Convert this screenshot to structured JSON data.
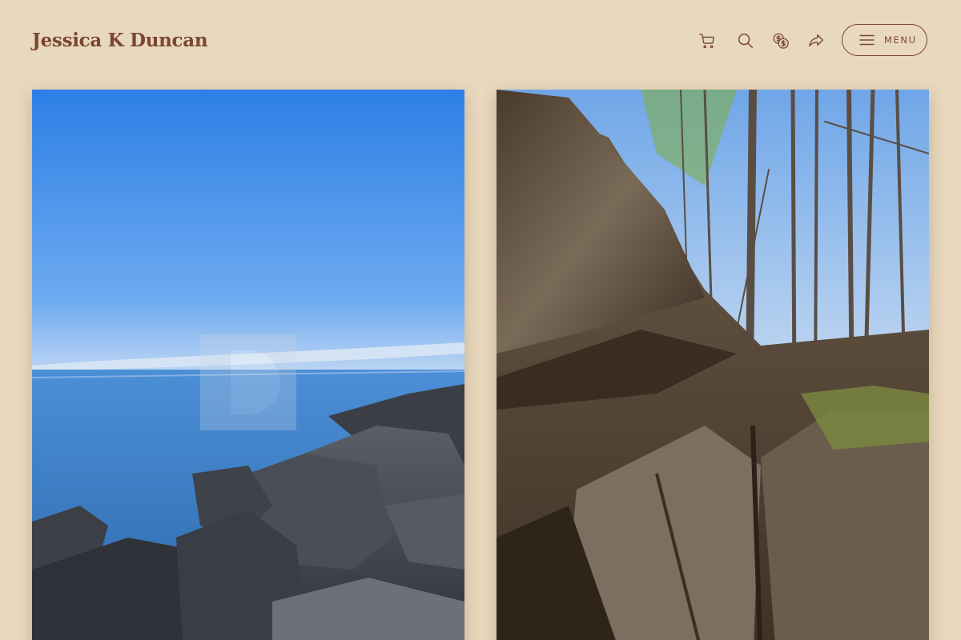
{
  "header": {
    "site_title": "Jessica K Duncan",
    "menu_label": "MENU",
    "icons": [
      "cart-icon",
      "search-icon",
      "currency-icon",
      "share-icon",
      "hamburger-icon"
    ]
  },
  "gallery": {
    "photos": [
      {
        "subject": "lake-shore-rocks",
        "watermark": "watermark-logo"
      },
      {
        "subject": "fallen-log-forest"
      }
    ]
  },
  "colors": {
    "background": "#e8d8bd",
    "brand": "#7a4632",
    "icon": "#7a4632"
  }
}
